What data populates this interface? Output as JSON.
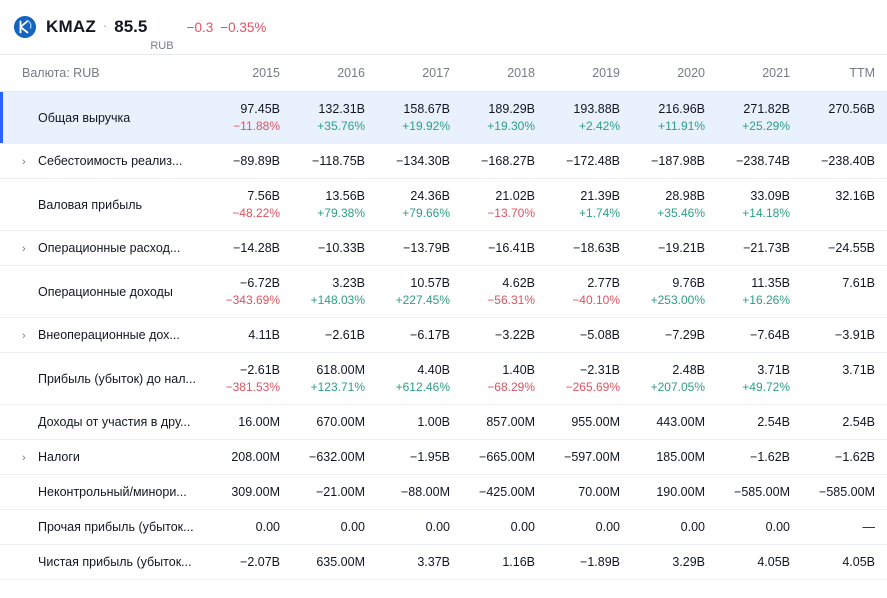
{
  "ticker": {
    "logo_icon": "company-logo-icon",
    "symbol": "KMAZ",
    "separator": "·",
    "price": "85.5",
    "currency": "RUB",
    "change": "−0.3",
    "change_pct": "−0.35%",
    "change_color": "#e05260"
  },
  "table": {
    "label_header": "Валюта: RUB",
    "columns": [
      "2015",
      "2016",
      "2017",
      "2018",
      "2019",
      "2020",
      "2021",
      "TTM"
    ],
    "colors": {
      "up": "#2e9e87",
      "down": "#e05260",
      "accent": "#2962ff",
      "highlight_bg": "#e8f1fc"
    },
    "rows": [
      {
        "label": "Общая выручка",
        "expandable": false,
        "highlight": true,
        "values": [
          "97.45B",
          "132.31B",
          "158.67B",
          "189.29B",
          "193.88B",
          "216.96B",
          "271.82B",
          "270.56B"
        ],
        "pcts": [
          "−11.88%",
          "+35.76%",
          "+19.92%",
          "+19.30%",
          "+2.42%",
          "+11.91%",
          "+25.29%",
          ""
        ]
      },
      {
        "label": "Себестоимость реализ...",
        "expandable": true,
        "highlight": false,
        "values": [
          "−89.89B",
          "−118.75B",
          "−134.30B",
          "−168.27B",
          "−172.48B",
          "−187.98B",
          "−238.74B",
          "−238.40B"
        ],
        "pcts": [
          "",
          "",
          "",
          "",
          "",
          "",
          "",
          ""
        ]
      },
      {
        "label": "Валовая прибыль",
        "expandable": false,
        "highlight": false,
        "values": [
          "7.56B",
          "13.56B",
          "24.36B",
          "21.02B",
          "21.39B",
          "28.98B",
          "33.09B",
          "32.16B"
        ],
        "pcts": [
          "−48.22%",
          "+79.38%",
          "+79.66%",
          "−13.70%",
          "+1.74%",
          "+35.46%",
          "+14.18%",
          ""
        ]
      },
      {
        "label": "Операционные расход...",
        "expandable": true,
        "highlight": false,
        "values": [
          "−14.28B",
          "−10.33B",
          "−13.79B",
          "−16.41B",
          "−18.63B",
          "−19.21B",
          "−21.73B",
          "−24.55B"
        ],
        "pcts": [
          "",
          "",
          "",
          "",
          "",
          "",
          "",
          ""
        ]
      },
      {
        "label": "Операционные доходы",
        "expandable": false,
        "highlight": false,
        "values": [
          "−6.72B",
          "3.23B",
          "10.57B",
          "4.62B",
          "2.77B",
          "9.76B",
          "11.35B",
          "7.61B"
        ],
        "pcts": [
          "−343.69%",
          "+148.03%",
          "+227.45%",
          "−56.31%",
          "−40.10%",
          "+253.00%",
          "+16.26%",
          ""
        ]
      },
      {
        "label": "Внеоперационные дох...",
        "expandable": true,
        "highlight": false,
        "values": [
          "4.11B",
          "−2.61B",
          "−6.17B",
          "−3.22B",
          "−5.08B",
          "−7.29B",
          "−7.64B",
          "−3.91B"
        ],
        "pcts": [
          "",
          "",
          "",
          "",
          "",
          "",
          "",
          ""
        ]
      },
      {
        "label": "Прибыль (убыток) до нал...",
        "expandable": false,
        "highlight": false,
        "values": [
          "−2.61B",
          "618.00M",
          "4.40B",
          "1.40B",
          "−2.31B",
          "2.48B",
          "3.71B",
          "3.71B"
        ],
        "pcts": [
          "−381.53%",
          "+123.71%",
          "+612.46%",
          "−68.29%",
          "−265.69%",
          "+207.05%",
          "+49.72%",
          ""
        ]
      },
      {
        "label": "Доходы от участия в дру...",
        "expandable": false,
        "highlight": false,
        "values": [
          "16.00M",
          "670.00M",
          "1.00B",
          "857.00M",
          "955.00M",
          "443.00M",
          "2.54B",
          "2.54B"
        ],
        "pcts": [
          "",
          "",
          "",
          "",
          "",
          "",
          "",
          ""
        ]
      },
      {
        "label": "Налоги",
        "expandable": true,
        "highlight": false,
        "values": [
          "208.00M",
          "−632.00M",
          "−1.95B",
          "−665.00M",
          "−597.00M",
          "185.00M",
          "−1.62B",
          "−1.62B"
        ],
        "pcts": [
          "",
          "",
          "",
          "",
          "",
          "",
          "",
          ""
        ]
      },
      {
        "label": "Неконтрольный/минори...",
        "expandable": false,
        "highlight": false,
        "values": [
          "309.00M",
          "−21.00M",
          "−88.00M",
          "−425.00M",
          "70.00M",
          "190.00M",
          "−585.00M",
          "−585.00M"
        ],
        "pcts": [
          "",
          "",
          "",
          "",
          "",
          "",
          "",
          ""
        ]
      },
      {
        "label": "Прочая прибыль (убыток...",
        "expandable": false,
        "highlight": false,
        "values": [
          "0.00",
          "0.00",
          "0.00",
          "0.00",
          "0.00",
          "0.00",
          "0.00",
          "—"
        ],
        "pcts": [
          "",
          "",
          "",
          "",
          "",
          "",
          "",
          ""
        ]
      },
      {
        "label": "Чистая прибыль (убыток...",
        "expandable": false,
        "highlight": false,
        "values": [
          "−2.07B",
          "635.00M",
          "3.37B",
          "1.16B",
          "−1.89B",
          "3.29B",
          "4.05B",
          "4.05B"
        ],
        "pcts": [
          "",
          "",
          "",
          "",
          "",
          "",
          "",
          ""
        ]
      }
    ]
  }
}
